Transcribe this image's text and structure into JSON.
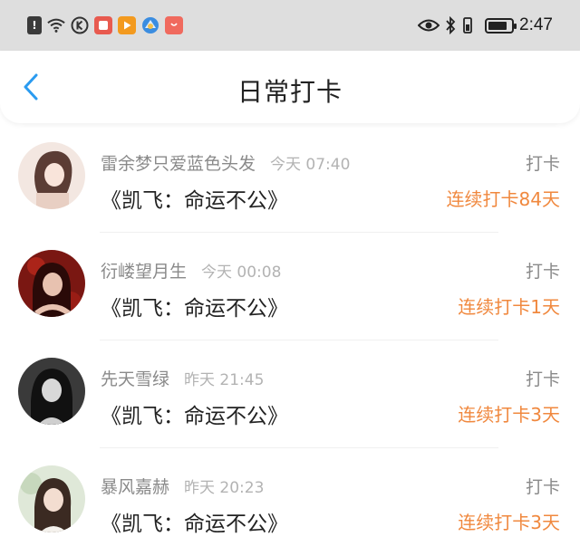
{
  "status_bar": {
    "time": "2:47",
    "left_icons": [
      "alert-icon",
      "wifi-icon",
      "k-app-icon",
      "red-app-icon",
      "video-app-icon",
      "browser-icon",
      "shopping-icon"
    ],
    "right_icons": [
      "eye-icon",
      "bluetooth-icon",
      "vibrate-icon",
      "battery-icon"
    ],
    "battery_level": 0.85
  },
  "header": {
    "title": "日常打卡",
    "back_icon": "chevron-left-icon",
    "accent_color": "#2a9bf0"
  },
  "colors": {
    "streak": "#f0883e",
    "name": "#8a8a8a",
    "time": "#b3b3b3"
  },
  "items": [
    {
      "name": "雷余梦只爱蓝色头发",
      "time": "今天 07:40",
      "action": "打卡",
      "content": "《凯飞：命运不公》",
      "streak": "连续打卡84天"
    },
    {
      "name": "衍嵝望月生",
      "time": "今天 00:08",
      "action": "打卡",
      "content": "《凯飞：命运不公》",
      "streak": "连续打卡1天"
    },
    {
      "name": "先天雪绿",
      "time": "昨天 21:45",
      "action": "打卡",
      "content": "《凯飞：命运不公》",
      "streak": "连续打卡3天"
    },
    {
      "name": "暴风嘉赫",
      "time": "昨天 20:23",
      "action": "打卡",
      "content": "《凯飞：命运不公》",
      "streak": "连续打卡3天"
    }
  ]
}
